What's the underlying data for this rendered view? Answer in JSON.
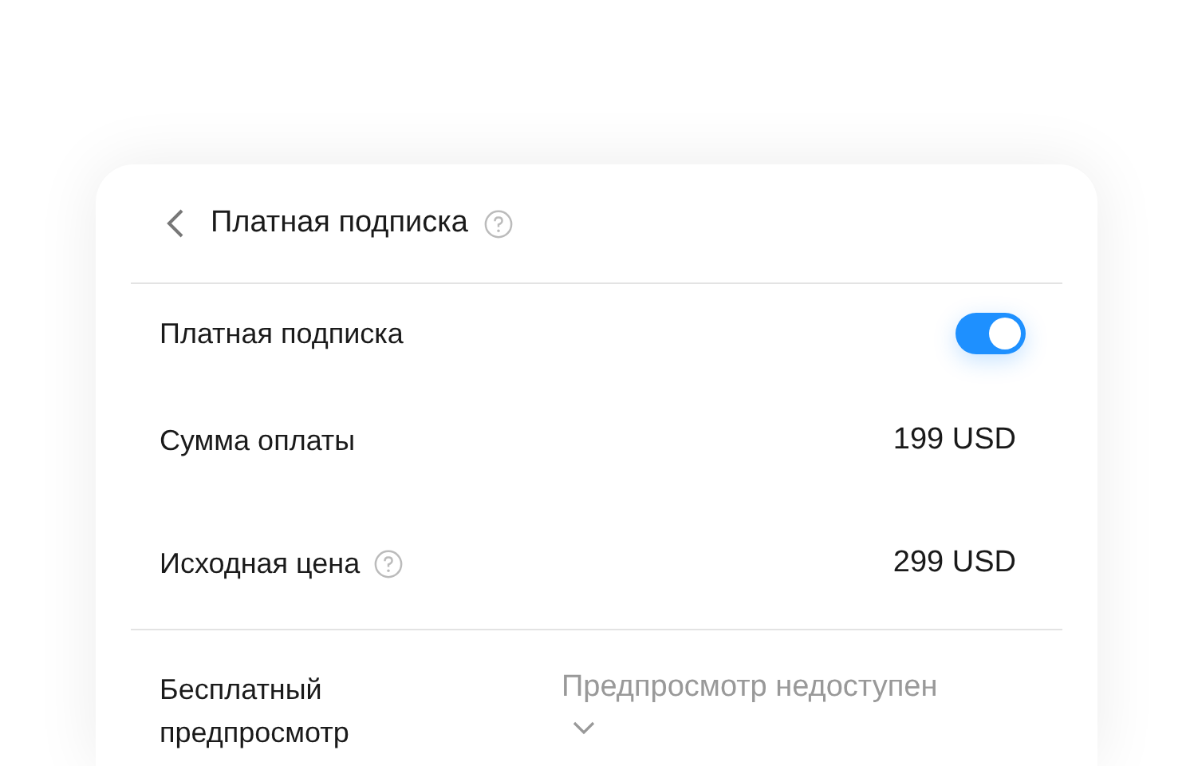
{
  "header": {
    "title": "Платная подписка"
  },
  "rows": [
    {
      "kind": "toggle",
      "label": "Платная подписка",
      "on": true,
      "help": false
    },
    {
      "kind": "value",
      "label": "Сумма оплаты",
      "value": "199 USD",
      "help": false
    },
    {
      "kind": "value",
      "label": "Исходная цена",
      "value": "299 USD",
      "help": true
    }
  ],
  "preview": {
    "label": "Бесплатный предпросмотр",
    "value": "Предпросмотр недоступен"
  }
}
